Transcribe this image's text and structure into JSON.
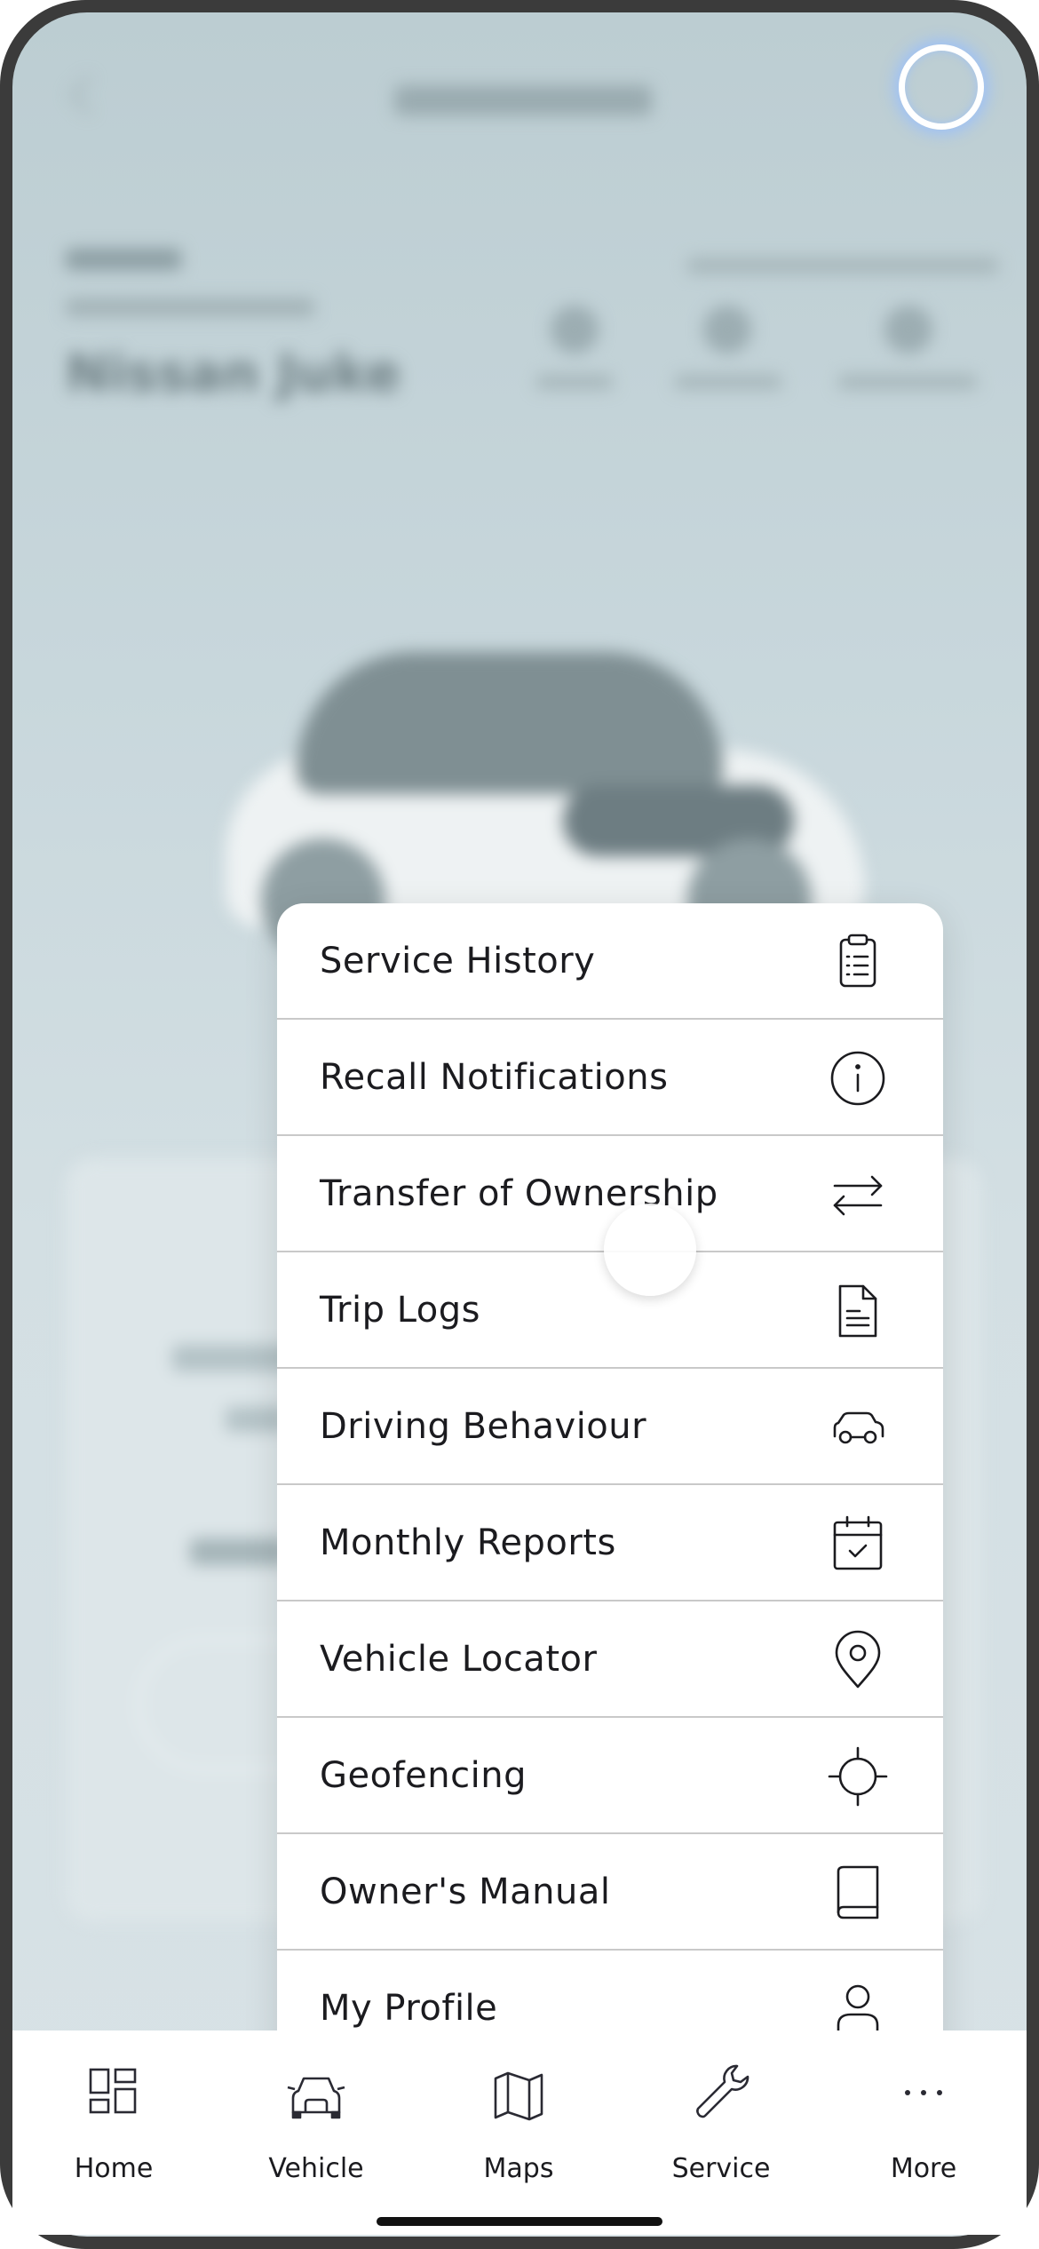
{
  "background": {
    "vehicle_name": "Nissan Juke"
  },
  "menu": {
    "items": [
      {
        "label": "Service History",
        "icon": "clipboard-list-icon"
      },
      {
        "label": "Recall Notifications",
        "icon": "info-circle-icon"
      },
      {
        "label": "Transfer of Ownership",
        "icon": "arrows-swap-icon"
      },
      {
        "label": "Trip Logs",
        "icon": "document-icon"
      },
      {
        "label": "Driving Behaviour",
        "icon": "car-icon"
      },
      {
        "label": "Monthly Reports",
        "icon": "calendar-check-icon"
      },
      {
        "label": "Vehicle Locator",
        "icon": "map-pin-icon"
      },
      {
        "label": "Geofencing",
        "icon": "crosshair-icon"
      },
      {
        "label": "Owner's Manual",
        "icon": "book-icon"
      },
      {
        "label": "My Profile",
        "icon": "person-icon"
      }
    ]
  },
  "bottom_nav": {
    "items": [
      {
        "label": "Home",
        "icon": "grid-icon"
      },
      {
        "label": "Vehicle",
        "icon": "vehicle-icon"
      },
      {
        "label": "Maps",
        "icon": "map-icon"
      },
      {
        "label": "Service",
        "icon": "wrench-icon"
      },
      {
        "label": "More",
        "icon": "more-dots-icon"
      }
    ]
  }
}
